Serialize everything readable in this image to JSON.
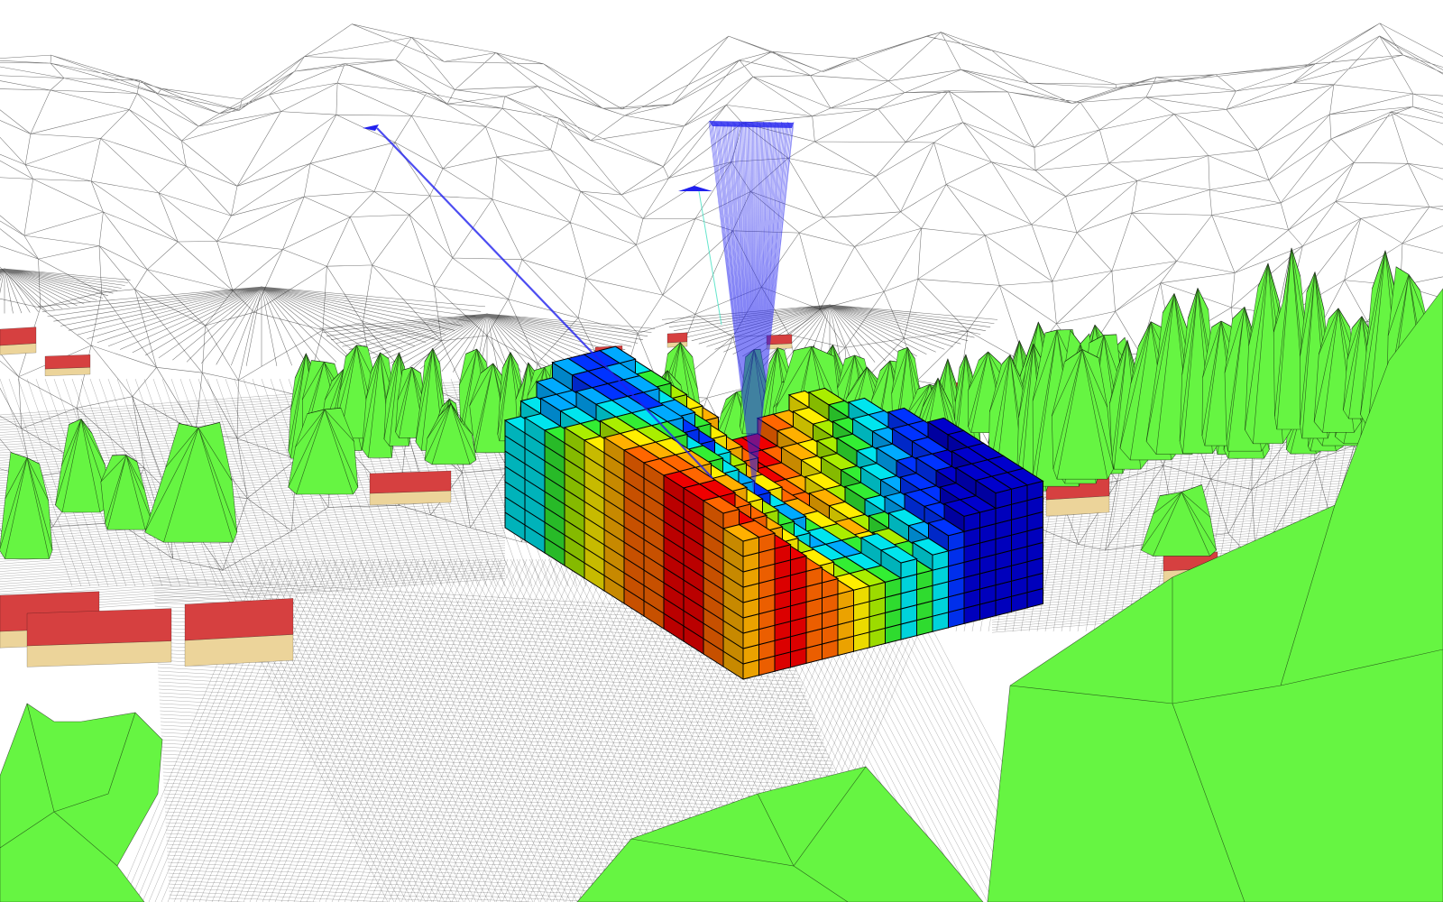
{
  "scene": {
    "colors": {
      "background": "#ffffff",
      "terrain_fill": "#ffffff",
      "mesh_line": "#000000",
      "tree": "#66f542",
      "roof": "#d64040",
      "wall": "#ecd49a",
      "ray": "#2020ee",
      "ray_secondary": "#40e0c0"
    },
    "colormap": [
      "#0000cc",
      "#0033ff",
      "#00aaff",
      "#00e5ee",
      "#33ee33",
      "#aaee00",
      "#ffee00",
      "#ffb000",
      "#ff6600",
      "#ee0000"
    ],
    "voxel_columns": [
      [
        3,
        3,
        2,
        2,
        1,
        1,
        2,
        3,
        4,
        5,
        6,
        7,
        8,
        8,
        9,
        9,
        8,
        7,
        6
      ],
      [
        3,
        2,
        2,
        1,
        1,
        2,
        3,
        4,
        5,
        6,
        7,
        8,
        9,
        9,
        9,
        8,
        7,
        6,
        5
      ],
      [
        4,
        3,
        2,
        1,
        1,
        2,
        3,
        5,
        6,
        7,
        8,
        9,
        9,
        9,
        8,
        7,
        6,
        5,
        4
      ],
      [
        5,
        4,
        3,
        2,
        1,
        1,
        2,
        4,
        6,
        7,
        8,
        9,
        9,
        8,
        7,
        6,
        5,
        4,
        3
      ],
      [
        6,
        5,
        4,
        3,
        2,
        1,
        1,
        3,
        5,
        7,
        8,
        9,
        9,
        8,
        6,
        5,
        4,
        3,
        2
      ],
      [
        7,
        6,
        5,
        4,
        3,
        2,
        1,
        2,
        4,
        6,
        8,
        9,
        9,
        7,
        5,
        4,
        3,
        2,
        1
      ],
      [
        8,
        7,
        6,
        5,
        4,
        3,
        2,
        1,
        3,
        5,
        7,
        9,
        8,
        6,
        4,
        3,
        2,
        1,
        1
      ],
      [
        8,
        8,
        7,
        6,
        5,
        4,
        3,
        2,
        2,
        4,
        6,
        8,
        7,
        5,
        3,
        2,
        1,
        1,
        0
      ],
      [
        9,
        8,
        8,
        7,
        6,
        5,
        4,
        3,
        2,
        3,
        5,
        7,
        6,
        4,
        2,
        1,
        1,
        0,
        0
      ],
      [
        9,
        9,
        8,
        8,
        7,
        6,
        5,
        4,
        3,
        2,
        4,
        6,
        5,
        3,
        1,
        1,
        0,
        0,
        0
      ],
      [
        8,
        9,
        9,
        8,
        8,
        7,
        6,
        5,
        4,
        3,
        3,
        5,
        4,
        2,
        1,
        0,
        0,
        0,
        0
      ],
      [
        7,
        8,
        9,
        9,
        8,
        8,
        7,
        6,
        5,
        4,
        3,
        4,
        3,
        1,
        0,
        0,
        0,
        0,
        0
      ]
    ],
    "trees_count_label": "",
    "houses_count_label": ""
  }
}
